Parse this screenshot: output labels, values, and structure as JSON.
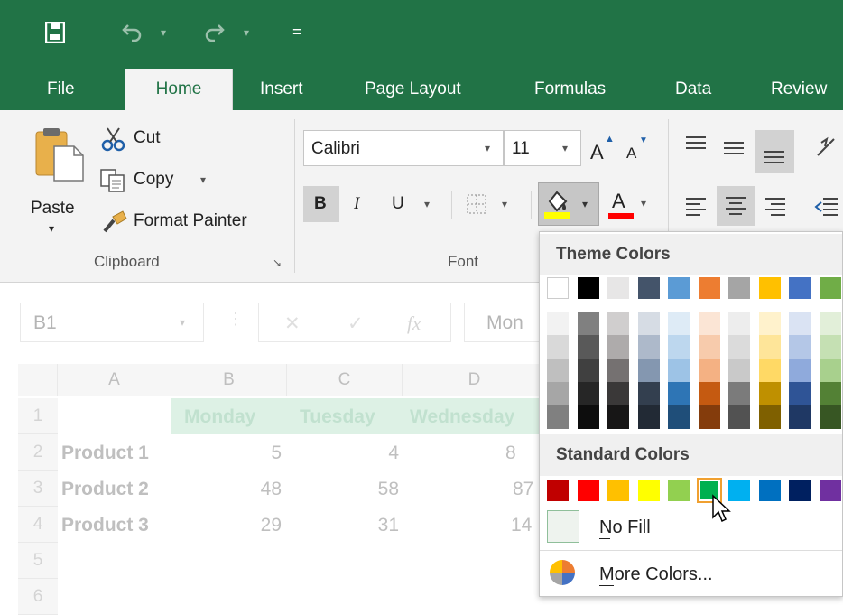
{
  "titlebar": {
    "customize_qat": "="
  },
  "tabs": [
    "File",
    "Home",
    "Insert",
    "Page Layout",
    "Formulas",
    "Data",
    "Review"
  ],
  "clipboard": {
    "paste": "Paste",
    "cut": "Cut",
    "copy": "Copy",
    "format_painter": "Format Painter",
    "group_label": "Clipboard"
  },
  "font": {
    "name": "Calibri",
    "size": "11",
    "grow": "A",
    "shrink": "A",
    "bold": "B",
    "italic": "I",
    "underline": "U",
    "font_color_letter": "A",
    "group_label": "Font"
  },
  "formula_bar": {
    "name_box": "B1",
    "fx": "fx",
    "content": "Mon"
  },
  "sheet": {
    "columns": [
      "A",
      "B",
      "C",
      "D"
    ],
    "row_numbers": [
      "1",
      "2",
      "3",
      "4",
      "5",
      "6"
    ],
    "header_row": [
      "Monday",
      "Tuesday",
      "Wednesday"
    ],
    "rows": [
      {
        "label": "Product 1",
        "values": [
          "5",
          "4",
          "8"
        ]
      },
      {
        "label": "Product 2",
        "values": [
          "48",
          "58",
          "87"
        ]
      },
      {
        "label": "Product 3",
        "values": [
          "29",
          "31",
          "14"
        ]
      }
    ]
  },
  "fill_menu": {
    "theme_header": "Theme Colors",
    "standard_header": "Standard Colors",
    "no_fill": "No Fill",
    "more_colors": "More Colors...",
    "theme_top": [
      "#ffffff",
      "#000000",
      "#e7e6e6",
      "#44546a",
      "#5b9bd5",
      "#ed7d31",
      "#a5a5a5",
      "#ffc000",
      "#4472c4",
      "#70ad47"
    ],
    "theme_shades": [
      [
        "#f2f2f2",
        "#d9d9d9",
        "#bfbfbf",
        "#a6a6a6",
        "#808080"
      ],
      [
        "#808080",
        "#595959",
        "#404040",
        "#262626",
        "#0d0d0d"
      ],
      [
        "#d0cece",
        "#aeabab",
        "#757171",
        "#3a3838",
        "#171616"
      ],
      [
        "#d6dce4",
        "#adb9ca",
        "#8497b0",
        "#333f4f",
        "#222a35"
      ],
      [
        "#deebf6",
        "#bdd7ee",
        "#9dc3e6",
        "#2e75b5",
        "#1f4e79"
      ],
      [
        "#fbe5d5",
        "#f7cbac",
        "#f4b183",
        "#c55a11",
        "#843c0c"
      ],
      [
        "#ededed",
        "#dbdbdb",
        "#c9c9c9",
        "#7b7b7b",
        "#525252"
      ],
      [
        "#fff2cc",
        "#fee599",
        "#ffd965",
        "#bf9000",
        "#7f6000"
      ],
      [
        "#dae3f3",
        "#b4c7e7",
        "#8faadc",
        "#2f5496",
        "#1f3864"
      ],
      [
        "#e2efd9",
        "#c5e0b3",
        "#a8d08d",
        "#538135",
        "#375623"
      ]
    ],
    "standard": [
      "#c00000",
      "#ff0000",
      "#ffc000",
      "#ffff00",
      "#92d050",
      "#00b050",
      "#00b0f0",
      "#0070c0",
      "#002060",
      "#7030a0"
    ],
    "selected_standard_index": 5
  }
}
